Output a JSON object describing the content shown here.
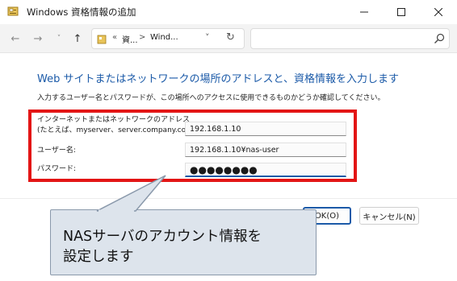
{
  "window": {
    "title": "Windows 資格情報の追加",
    "minimize_icon": "minimize-icon",
    "maximize_icon": "maximize-icon",
    "close_icon": "close-icon"
  },
  "navigation": {
    "back": "←",
    "forward": "→",
    "recent": "˅",
    "up": "↑",
    "address": {
      "separator": "«",
      "crumb1": "資...",
      "crumb_separator": ">",
      "crumb2": "Wind...",
      "dropdown": "˅",
      "refresh": "↻"
    },
    "search": {
      "value": ""
    }
  },
  "form": {
    "heading": "Web サイトまたはネットワークの場所のアドレスと、資格情報を入力します",
    "instruction": "入力するユーザー名とパスワードが、この場所へのアクセスに使用できるものかどうか確認してください。",
    "address_label_line1": "インターネットまたはネットワークのアドレス",
    "address_label_line2": "(たとえば、myserver、server.company.com):",
    "address_value": "192.168.1.10",
    "username_label": "ユーザー名:",
    "username_value": "192.168.1.10¥nas-user",
    "password_label": "パスワード:",
    "password_value": "●●●●●●●●"
  },
  "buttons": {
    "ok": "OK(O)",
    "cancel": "キャンセル(N)"
  },
  "annotation": {
    "callout_text": "NASサーバのアカウント情報を\n設定します",
    "highlight_color": "#e31515",
    "callout_fill": "#dde4ec"
  },
  "colors": {
    "accent": "#1b5aa8"
  }
}
